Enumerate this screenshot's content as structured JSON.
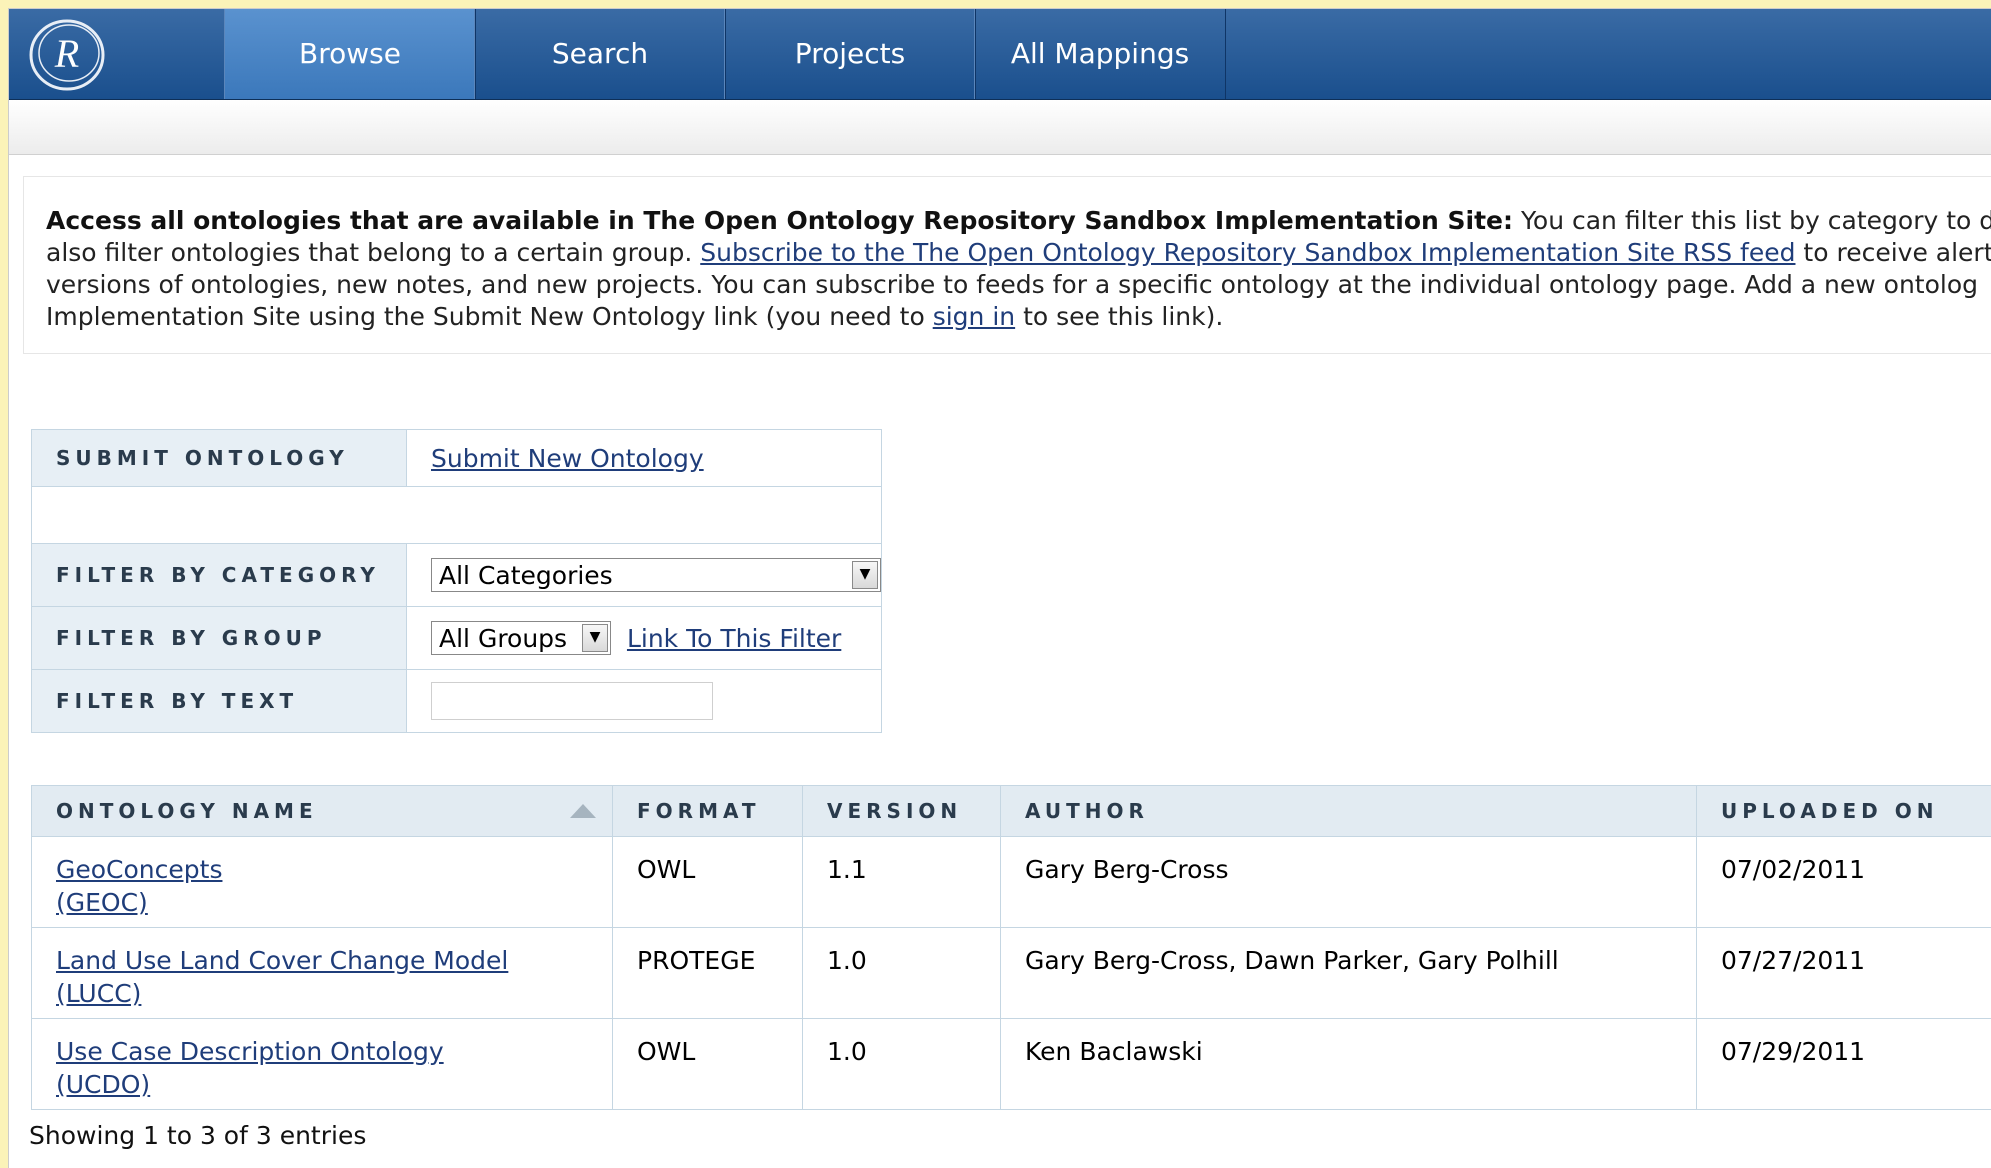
{
  "nav": {
    "logo": "R",
    "tabs": [
      {
        "label": "Browse",
        "active": true
      },
      {
        "label": "Search",
        "active": false
      },
      {
        "label": "Projects",
        "active": false
      },
      {
        "label": "All Mappings",
        "active": false
      }
    ]
  },
  "intro": {
    "bold": "Access all ontologies that are available in The Open Ontology Repository Sandbox Implementation Site:",
    "text1": " You can filter this list by category to display or",
    "text2": "also filter ontologies that belong to a certain group. ",
    "rss_link": "Subscribe to the The Open Ontology Repository Sandbox Implementation Site RSS feed",
    "text3": " to receive alert",
    "text4": "versions of ontologies, new notes, and new projects. You can subscribe to feeds for a specific ontology at the individual ontology page. Add a new ontolog",
    "text5": "Implementation Site using the Submit New Ontology link (you need to ",
    "signin_link": "sign in",
    "text6": " to see this link)."
  },
  "filters": {
    "submit_label": "SUBMIT ONTOLOGY",
    "submit_link": "Submit New Ontology",
    "category_label": "FILTER BY CATEGORY",
    "category_value": "All Categories",
    "group_label": "FILTER BY GROUP",
    "group_value": "All Groups",
    "group_link": "Link To This Filter",
    "text_label": "FILTER BY TEXT",
    "text_value": ""
  },
  "table": {
    "headers": [
      "ONTOLOGY NAME",
      "FORMAT",
      "VERSION",
      "AUTHOR",
      "UPLOADED ON"
    ],
    "rows": [
      {
        "name": "GeoConcepts",
        "abbr": "(GEOC)",
        "format": "OWL",
        "version": "1.1",
        "author": "Gary Berg-Cross",
        "uploaded": "07/02/2011"
      },
      {
        "name": "Land Use Land Cover Change Model",
        "abbr": "(LUCC)",
        "format": "PROTEGE",
        "version": "1.0",
        "author": "Gary Berg-Cross, Dawn Parker, Gary Polhill",
        "uploaded": "07/27/2011"
      },
      {
        "name": "Use Case Description Ontology",
        "abbr": "(UCDO)",
        "format": "OWL",
        "version": "1.0",
        "author": "Ken Baclawski",
        "uploaded": "07/29/2011"
      }
    ],
    "info": "Showing 1 to 3 of 3 entries"
  }
}
